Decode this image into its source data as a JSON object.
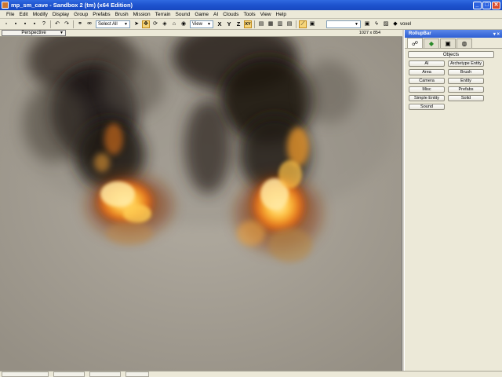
{
  "window": {
    "title": "mp_sm_cave - Sandbox 2 (tm) (x64 Edition)",
    "buttons": {
      "minimize": "_",
      "maximize": "□",
      "close": "✕"
    }
  },
  "menu": [
    "File",
    "Edit",
    "Modify",
    "Display",
    "Group",
    "Prefabs",
    "Brush",
    "Mission",
    "Terrain",
    "Sound",
    "Game",
    "AI",
    "Clouds",
    "Tools",
    "View",
    "Help"
  ],
  "toolbar": {
    "selection_combo": "Select All",
    "coord_combo": "View",
    "axes": [
      "X",
      "Y",
      "Z",
      "XY"
    ],
    "active_axis": "XY",
    "right_label": "voxel"
  },
  "viewport": {
    "title": "Perspective",
    "resolution": "1027 x 854"
  },
  "rollup": {
    "title": "RollupBar",
    "pin": "▾ ×",
    "category": "Objects",
    "buttons": [
      "AI",
      "Archetype Entity",
      "Area",
      "Brush",
      "Camera",
      "Entity",
      "Misc",
      "Prefabs",
      "Simple Entity",
      "Solid",
      "Sound"
    ]
  },
  "colors": {
    "titlebar": "#1f55d0",
    "terrain": "#a49e93",
    "smoke": "#1a1510",
    "fire_core": "#ffd45a",
    "fire_edge": "#d4621a"
  }
}
